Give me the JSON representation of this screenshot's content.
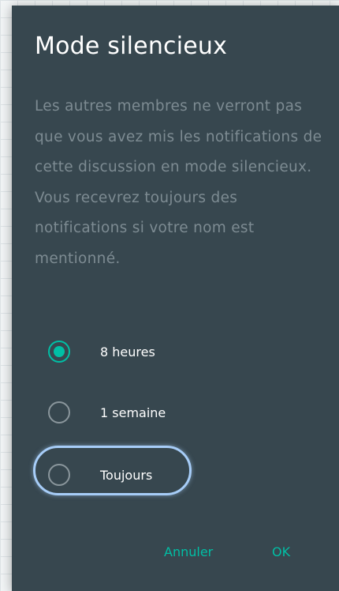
{
  "dialog": {
    "title": "Mode silencieux",
    "message": "Les autres membres ne verront pas que vous avez mis les notifications de cette discussion en mode silencieux. Vous recevrez toujours des notifications si votre nom est mentionné.",
    "options": [
      {
        "label": "8 heures",
        "selected": true
      },
      {
        "label": "1 semaine",
        "selected": false
      },
      {
        "label": "Toujours",
        "selected": false,
        "focused": true
      }
    ],
    "buttons": {
      "cancel": "Annuler",
      "ok": "OK"
    }
  },
  "colors": {
    "dialog_background": "#37474f",
    "accent": "#00bfa5",
    "focus_ring": "#a7cdf8",
    "message_text": "#7d8b92"
  }
}
